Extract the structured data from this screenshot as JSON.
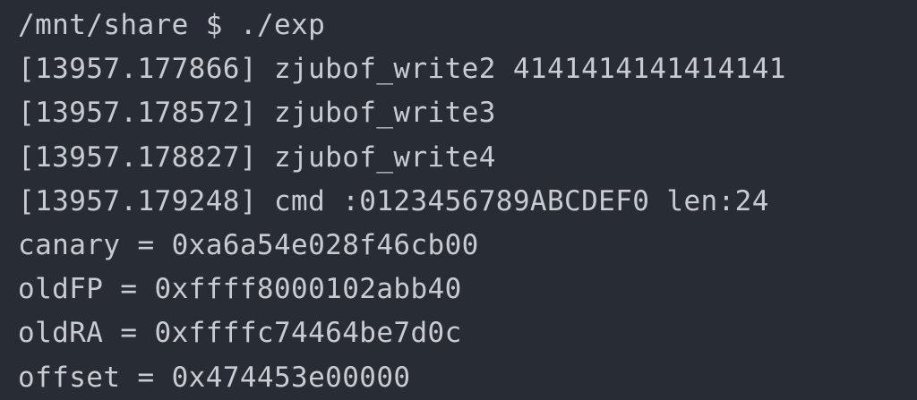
{
  "terminal": {
    "lines": [
      "/mnt/share $ ./exp",
      "[13957.177866] zjubof_write2 4141414141414141",
      "[13957.178572] zjubof_write3",
      "[13957.178827] zjubof_write4",
      "[13957.179248] cmd :0123456789ABCDEF0 len:24",
      "canary = 0xa6a54e028f46cb00",
      "oldFP = 0xffff8000102abb40",
      "oldRA = 0xffffc74464be7d0c",
      "offset = 0x474453e00000"
    ]
  },
  "colors": {
    "background": "#282c34",
    "text": "#c8ccd2"
  }
}
